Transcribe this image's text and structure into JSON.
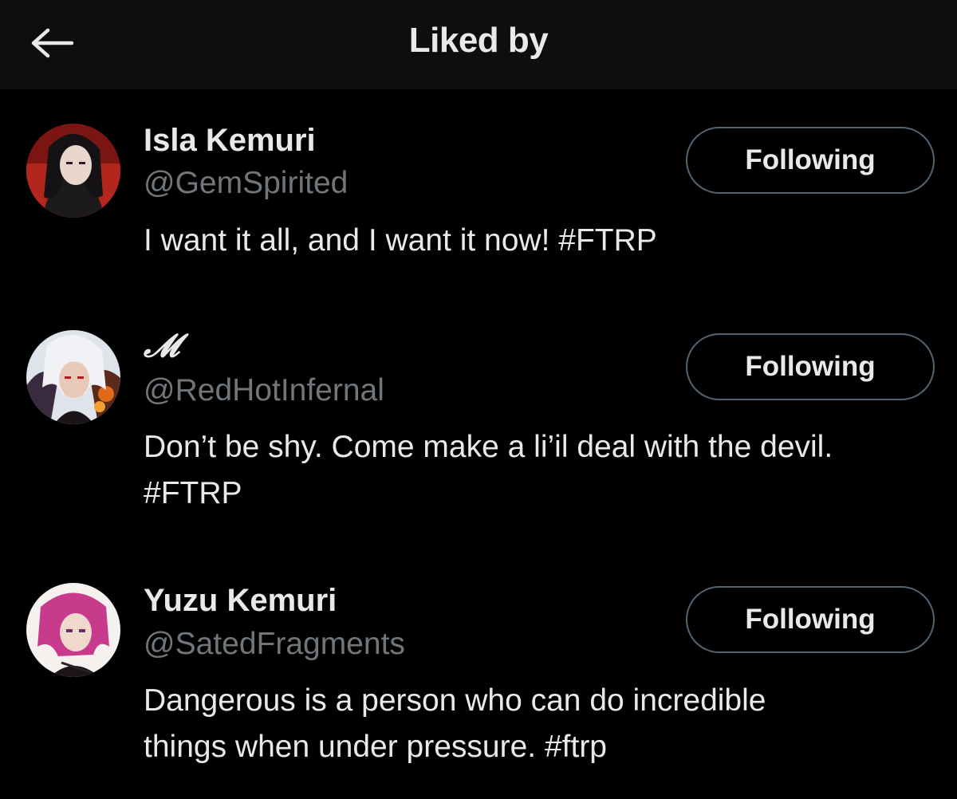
{
  "header": {
    "title": "Liked by",
    "back_icon": "arrow-left-icon"
  },
  "colors": {
    "background": "#000000",
    "header_background": "#0e0e0e",
    "primary_text": "#e7e9ea",
    "secondary_text": "#71767b",
    "button_border": "#536471"
  },
  "users": [
    {
      "name": "Isla Kemuri",
      "handle": "@GemSpirited",
      "bio_lines": [
        "I want it all, and I want it now! #FTRP"
      ],
      "button_label": "Following"
    },
    {
      "name": "𝓜",
      "handle": "@RedHotInfernal",
      "bio_lines": [
        "Don’t be shy. Come make a li’il deal with the devil.",
        "#FTRP"
      ],
      "button_label": "Following"
    },
    {
      "name": "Yuzu Kemuri",
      "handle": "@SatedFragments",
      "bio_lines": [
        "Dangerous is a person who can do incredible",
        "things when under pressure. #ftrp"
      ],
      "button_label": "Following"
    }
  ]
}
